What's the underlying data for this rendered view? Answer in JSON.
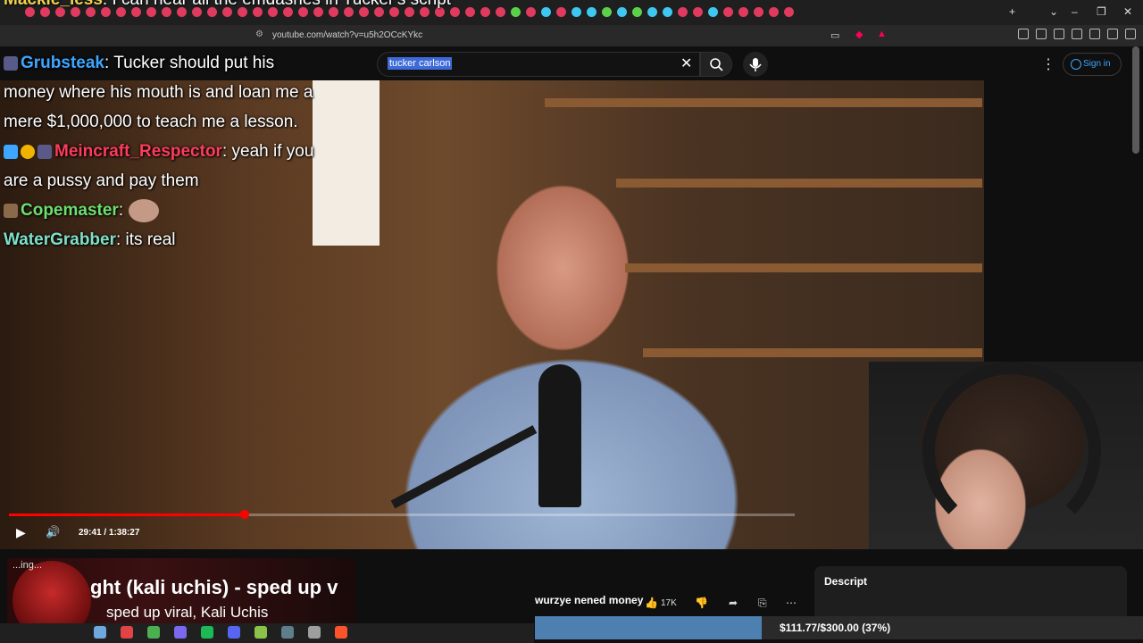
{
  "browser": {
    "url": "youtube.com/watch?v=u5h2OCcKYkc"
  },
  "youtube": {
    "search_value": "tucker carlson",
    "sign_in_label": "Sign in"
  },
  "chat": {
    "top_partial": {
      "user": "Mackle_less",
      "text": ": I can hear all the emdashes in Tucker's script"
    },
    "messages": [
      {
        "user": "Grubsteak",
        "text": ": Tucker should put his money where his mouth is and loan me a mere $1,000,000 to teach me a lesson.",
        "color": "#3ea6ff"
      },
      {
        "user": "Meincraft_Respector",
        "text": ": yeah if you are a pussy and pay them",
        "color": "#ff3b5c"
      },
      {
        "user": "Copemaster",
        "text": ":",
        "color": "#6de06d"
      },
      {
        "user": "WaterGrabber",
        "text": ": its real",
        "color": "#7fe0c8"
      }
    ]
  },
  "player": {
    "time": "29:41 / 1:38:27",
    "progress": 0.3
  },
  "now_playing": {
    "status": "...ing...",
    "song": "ght (kali uchis) - sped up v",
    "artist": "sped up viral, Kali Uchis"
  },
  "video": {
    "title": "wurzye nened money",
    "likes": "17K"
  },
  "description": {
    "label": "Descript"
  },
  "goal": {
    "text": "$111.77/$300.00 (37%)",
    "fraction": 0.3726
  },
  "colors": {
    "progress": "#ff0000",
    "goal_fill": "#4d7fb0",
    "link_blue": "#3ea6ff"
  }
}
